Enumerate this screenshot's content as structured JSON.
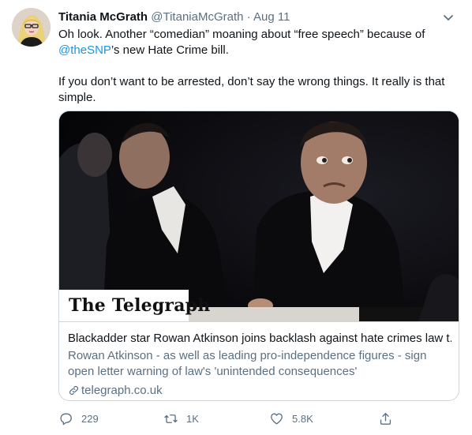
{
  "tweet": {
    "author_name": "Titania McGrath",
    "handle": "@TitaniaMcGrath",
    "separator": "·",
    "date": "Aug 11",
    "text_part1": "Oh look. Another “comedian” moaning about “free speech” because of ",
    "mention": "@theSNP",
    "text_part2": "’s new Hate Crime bill.",
    "text_para2": "If you don’t want to be arrested, don’t say the wrong things. It really is that simple."
  },
  "card": {
    "image_logo": "The Telegraph",
    "title": "Blackadder star Rowan Atkinson joins backlash against hate crimes law t...",
    "description": "Rowan Atkinson - as well as leading pro-independence figures - sign open letter warning of law's 'unintended consequences'",
    "domain": "telegraph.co.uk"
  },
  "actions": {
    "replies": "229",
    "retweets": "1K",
    "likes": "5.8K"
  },
  "colors": {
    "text": "#0f1419",
    "secondary": "#5b7083",
    "link": "#1b95e0",
    "border": "#ccd6dd"
  },
  "icons": [
    "caret-down-icon",
    "link-icon",
    "reply-icon",
    "retweet-icon",
    "like-icon",
    "share-icon"
  ]
}
